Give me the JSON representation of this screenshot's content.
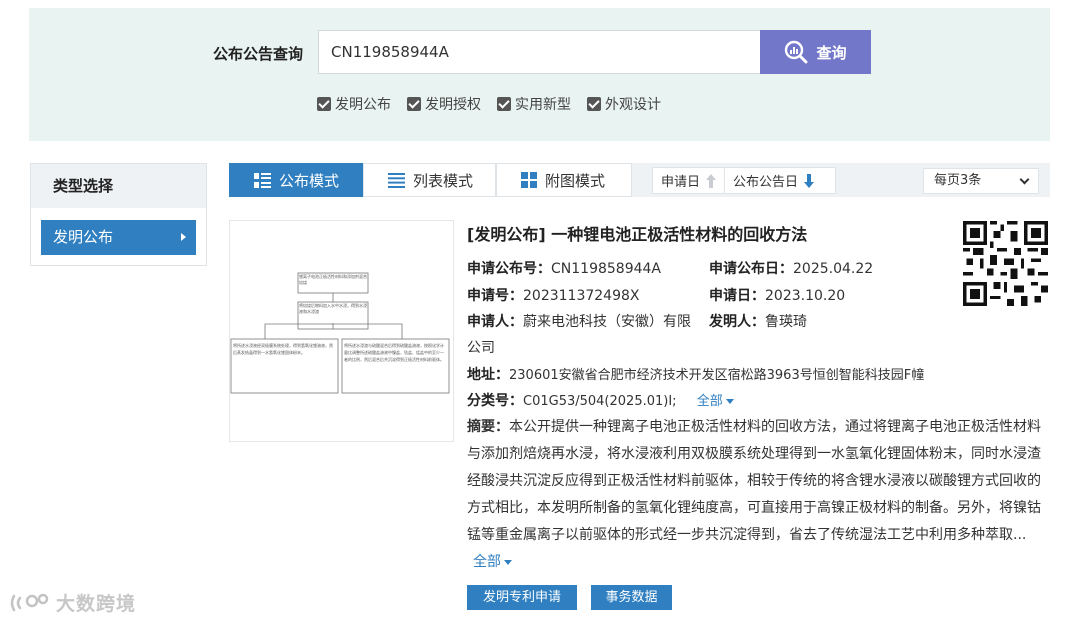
{
  "search": {
    "label": "公布公告查询",
    "value": "CN119858944A",
    "button_label": "查询",
    "button_icon": "magnifier-chart-icon",
    "filters": [
      {
        "label": "发明公布",
        "checked": true
      },
      {
        "label": "发明授权",
        "checked": true
      },
      {
        "label": "实用新型",
        "checked": true
      },
      {
        "label": "外观设计",
        "checked": true
      }
    ]
  },
  "sidebar": {
    "title": "类型选择",
    "items": [
      {
        "label": "发明公布",
        "active": true
      }
    ]
  },
  "toolbar": {
    "modes": [
      {
        "label": "公布模式",
        "icon": "list-layout-icon",
        "active": true
      },
      {
        "label": "列表模式",
        "icon": "lines-icon",
        "active": false
      },
      {
        "label": "附图模式",
        "icon": "grid-icon",
        "active": false
      }
    ],
    "sort": [
      {
        "label": "申请日",
        "direction": "up",
        "active": false
      },
      {
        "label": "公布公告日",
        "direction": "down",
        "active": true
      }
    ],
    "per_page": "每页3条"
  },
  "result": {
    "title": "[发明公布] 一种锂电池正极活性材料的回收方法",
    "pub_no_label": "申请公布号：",
    "pub_no": "CN119858944A",
    "pub_date_label": "申请公布日：",
    "pub_date": "2025.04.22",
    "app_no_label": "申请号：",
    "app_no": "202311372498X",
    "app_date_label": "申请日：",
    "app_date": "2023.10.20",
    "applicant_label": "申请人：",
    "applicant_line1": "蔚来电池科技（安徽）有限",
    "applicant_line2": "公司",
    "inventor_label": "发明人：",
    "inventor": "鲁瑛琦",
    "address_label": "地址：",
    "address": "230601安徽省合肥市经济技术开发区宿松路3963号恒创智能科技园F幢",
    "class_label": "分类号：",
    "class_no": "C01G53/504(2025.01)I;",
    "all_label": "全部",
    "abstract_label": "摘要：",
    "abstract_text": "本公开提供一种锂离子电池正极活性材料的回收方法，通过将锂离子电池正极活性材料与添加剂焙烧再水浸，将水浸液利用双极膜系统处理得到一水氢氧化锂固体粉末，同时水浸渣经酸浸共沉淀反应得到正极活性材料前驱体，相较于传统的将含锂水浸液以碳酸锂方式回收的方式相比，本发明所制备的氢氧化锂纯度高，可直接用于高镍正极材料的制备。另外，将镍钴锰等重金属离子以前驱体的形式经一步共沉淀得到，省去了传统湿法工艺中利用多种萃取...",
    "abstract_more": "全部",
    "buttons": [
      "发明专利申请",
      "事务数据"
    ]
  },
  "thumbnail": {
    "box1": "锂离子电池正极活性材料和添加剂混合焙烧",
    "box2": "将焙烧后物料加入水中水浸，得到水浸液和水浸渣",
    "box3": "将所述水浸液经双极膜系统处理，得到氢氧化锂溶液，然后蒸发结晶得到一水氢氧化锂固体粉末。",
    "box4": "将所述水浸渣与硫酸混合后得到硫酸盐溶液，按照化学计量比调整所述硫酸盐溶液中镍盐、钴盐、锰盐中的至少一者的比例，然后混合后共沉淀得到正极活性材料前驱体。"
  },
  "watermark": "大数跨境",
  "colors": {
    "primary": "#2f7fc1",
    "search_button": "#7377c9",
    "panel_bg": "#e9f3f1"
  }
}
